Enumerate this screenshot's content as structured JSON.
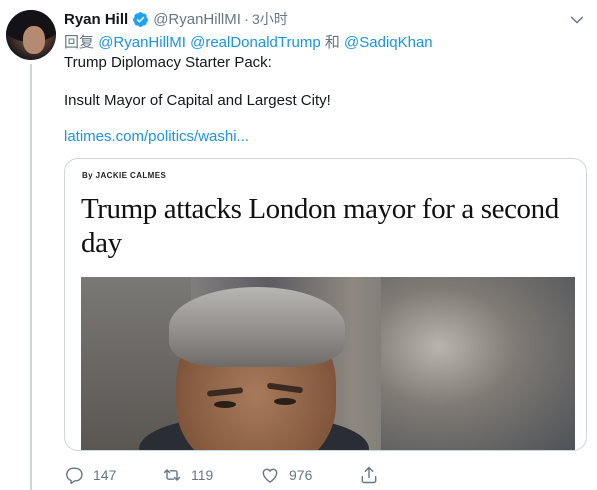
{
  "tweet": {
    "author": {
      "display_name": "Ryan Hill",
      "handle": "@RyanHillMI",
      "verified": true,
      "avatar_icon": "avatar-photo"
    },
    "separator": "·",
    "timestamp": "3小时",
    "reply_to": {
      "prefix": "回复",
      "mentions": [
        "@RyanHillMI",
        "@realDonaldTrump"
      ],
      "conjunction": "和",
      "last_mention": "@SadiqKhan"
    },
    "text_lines": [
      "Trump Diplomacy Starter Pack:",
      "Insult Mayor of Capital and Largest City!"
    ],
    "link_text": "latimes.com/politics/washi...",
    "card": {
      "byline": "By JACKIE CALMES",
      "headline": "Trump attacks London mayor for a second day"
    },
    "actions": {
      "reply_count": "147",
      "retweet_count": "119",
      "like_count": "976"
    },
    "colors": {
      "link": "#1b95e0",
      "secondary_text": "#657786",
      "verified_badge": "#1da1f2",
      "border": "#ccd6dd"
    },
    "icons": {
      "verified": "verified-badge-icon",
      "menu": "chevron-down-icon",
      "reply": "reply-icon",
      "retweet": "retweet-icon",
      "like": "heart-icon",
      "share": "share-icon"
    }
  }
}
